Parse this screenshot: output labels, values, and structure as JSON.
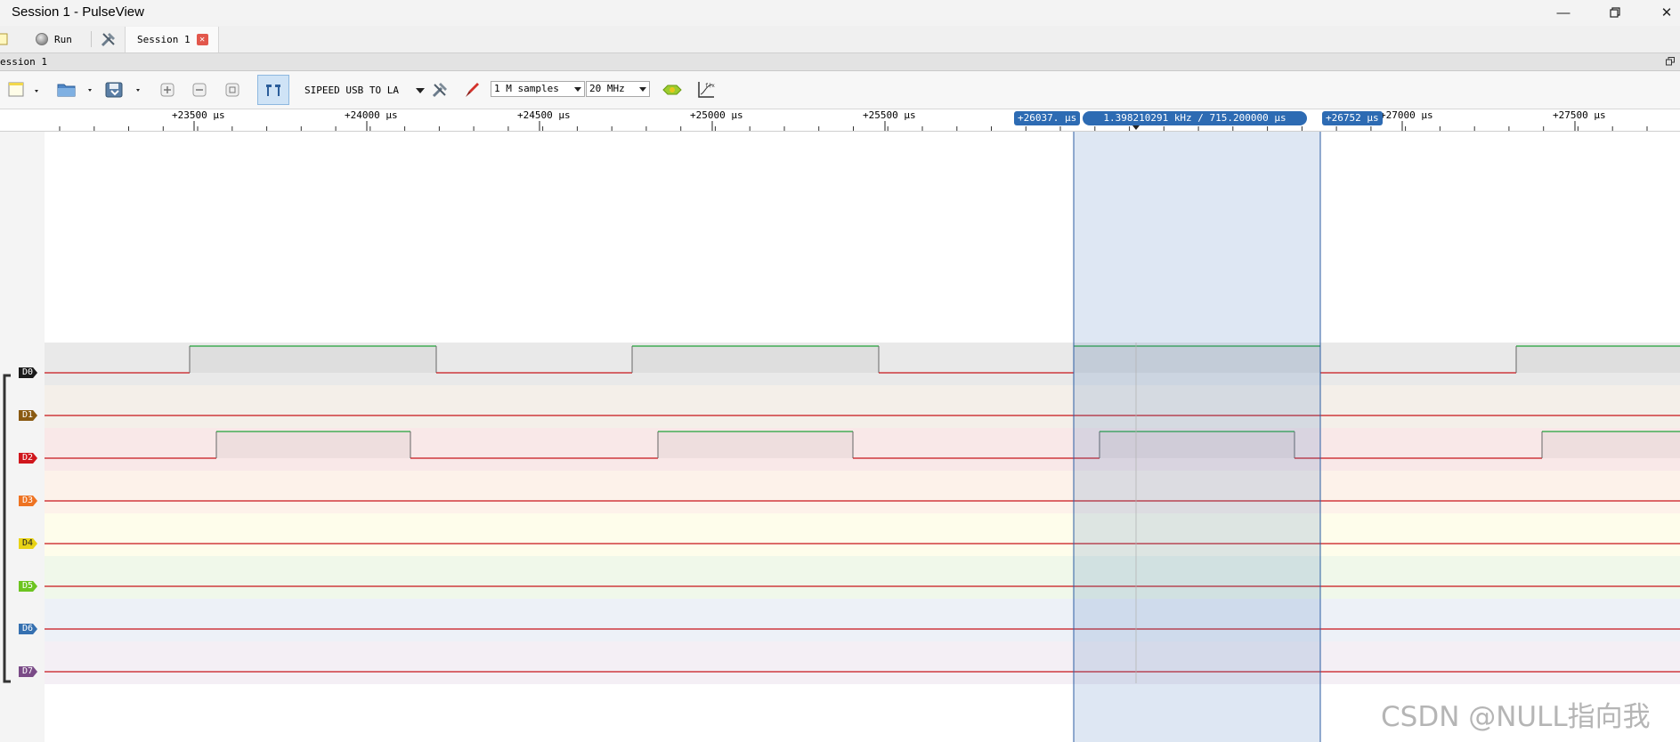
{
  "window": {
    "title": "Session 1 - PulseView"
  },
  "tabbar": {
    "run_label": "Run",
    "session_tab": "Session 1"
  },
  "session_bar": {
    "label": "ession 1"
  },
  "toolbar": {
    "device": "SIPEED USB TO LA",
    "samples": "1 M samples",
    "rate": "20 MHz"
  },
  "ruler": {
    "ticks": [
      {
        "label": "+23500",
        "unit": "µs"
      },
      {
        "label": "+24000",
        "unit": "µs"
      },
      {
        "label": "+24500",
        "unit": "µs"
      },
      {
        "label": "+25000",
        "unit": "µs"
      },
      {
        "label": "+25500",
        "unit": "µs"
      },
      {
        "label": "+27000",
        "unit": "µs"
      },
      {
        "label": "+27500",
        "unit": "µs"
      }
    ],
    "cursor_left": "+26037. µs",
    "cursor_measure": "1.398210291 kHz / 715.200000 µs",
    "cursor_right": "+26752 µs"
  },
  "channels": [
    {
      "name": "D0",
      "color": "#1a1a1a",
      "bg": "#e9e9e9"
    },
    {
      "name": "D1",
      "color": "#8a5a12",
      "bg": "#f4efe9"
    },
    {
      "name": "D2",
      "color": "#d0161c",
      "bg": "#f9e8e8"
    },
    {
      "name": "D3",
      "color": "#ee7322",
      "bg": "#fdf2ea"
    },
    {
      "name": "D4",
      "color": "#e8d316",
      "bg": "#fefdeb"
    },
    {
      "name": "D5",
      "color": "#6cc420",
      "bg": "#f0f8ea"
    },
    {
      "name": "D6",
      "color": "#3570b0",
      "bg": "#edf1f7"
    },
    {
      "name": "D7",
      "color": "#7a4b87",
      "bg": "#f4eff5"
    }
  ],
  "signals": {
    "D0_high": [
      [
        213,
        490
      ],
      [
        710,
        987
      ],
      [
        1206,
        1483
      ],
      [
        1703,
        1887
      ]
    ],
    "D2_high": [
      [
        243,
        461
      ],
      [
        739,
        958
      ],
      [
        1235,
        1454
      ],
      [
        1732,
        1887
      ]
    ]
  },
  "watermark": "CSDN @NULL指向我"
}
